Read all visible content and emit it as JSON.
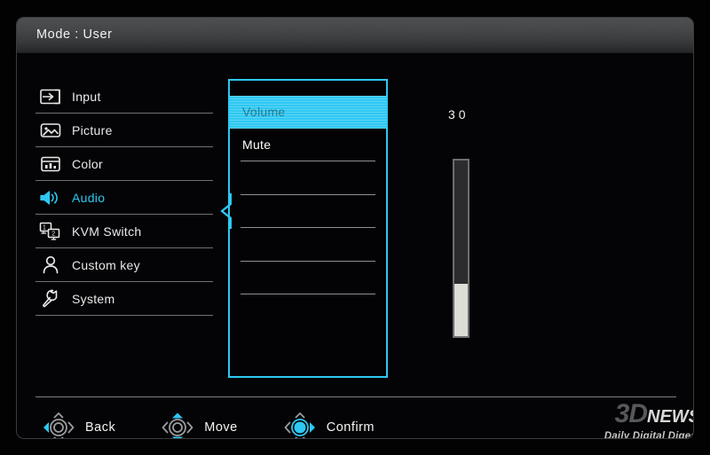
{
  "header": {
    "title": "Mode : User"
  },
  "categories": [
    {
      "label": "Input",
      "icon": "input-icon",
      "active": false
    },
    {
      "label": "Picture",
      "icon": "picture-icon",
      "active": false
    },
    {
      "label": "Color",
      "icon": "color-icon",
      "active": false
    },
    {
      "label": "Audio",
      "icon": "audio-icon",
      "active": true
    },
    {
      "label": "KVM Switch",
      "icon": "kvm-switch-icon",
      "active": false
    },
    {
      "label": "Custom key",
      "icon": "user-icon",
      "active": false
    },
    {
      "label": "System",
      "icon": "wrench-icon",
      "active": false
    }
  ],
  "submenu": {
    "items": [
      {
        "label": "Volume",
        "selected": true
      },
      {
        "label": "Mute",
        "selected": false
      },
      {
        "label": "",
        "selected": false
      },
      {
        "label": "",
        "selected": false
      },
      {
        "label": "",
        "selected": false
      },
      {
        "label": "",
        "selected": false
      },
      {
        "label": "",
        "selected": false
      },
      {
        "label": "",
        "selected": false
      }
    ]
  },
  "value_display": {
    "value": "30",
    "slider_percent": 30
  },
  "footer": {
    "actions": [
      {
        "label": "Back",
        "icon": "dpad-left-icon"
      },
      {
        "label": "Move",
        "icon": "dpad-updown-icon"
      },
      {
        "label": "Confirm",
        "icon": "dpad-center-icon"
      }
    ]
  },
  "watermark": {
    "logo_3d": "3D",
    "logo_news": "NEWS",
    "tagline": "Daily Digital Digest"
  },
  "colors": {
    "accent_cyan": "#2ec8f2",
    "selected_text": "#1a6f85",
    "panel_bg": "#040406",
    "separator": "#6f7173"
  }
}
